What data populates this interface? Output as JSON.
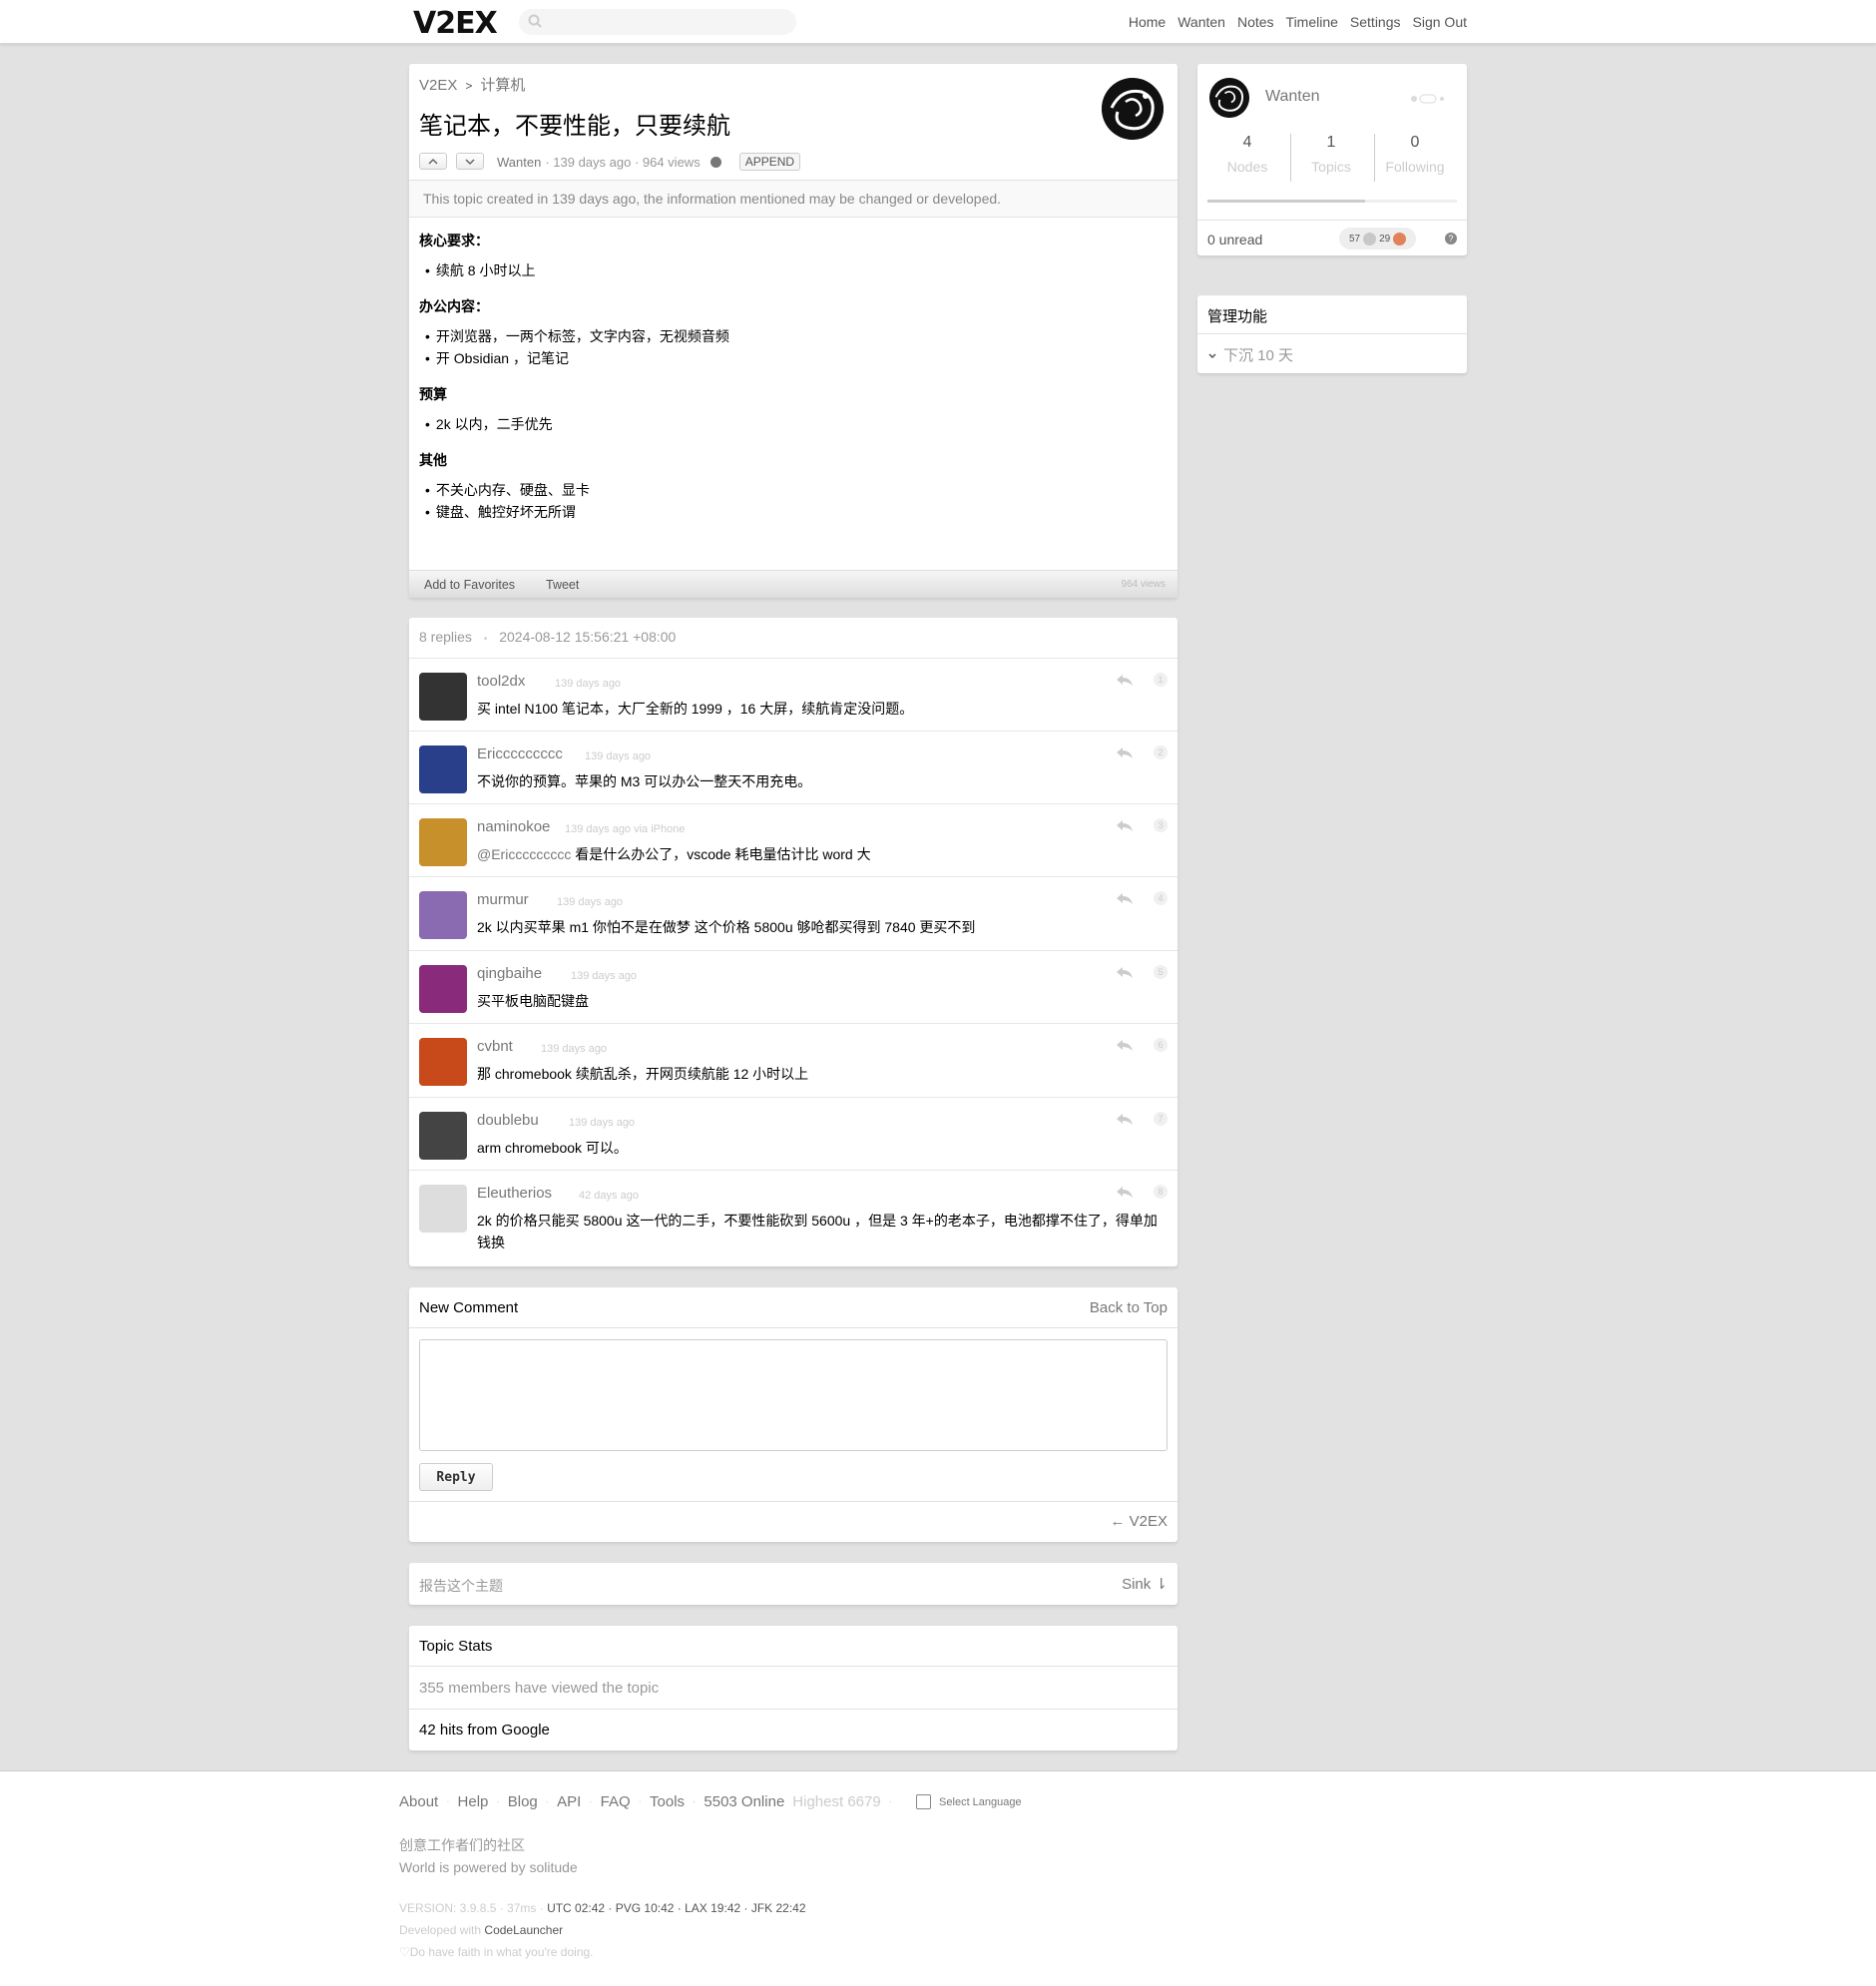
{
  "nav": {
    "logo": "V2EX",
    "links": [
      "Home",
      "Wanten",
      "Notes",
      "Timeline",
      "Settings",
      "Sign Out"
    ]
  },
  "topic": {
    "breadcrumb_home": "V2EX",
    "breadcrumb_sep": ">",
    "breadcrumb_node": "计算机",
    "title": "笔记本，不要性能，只要续航",
    "author": "Wanten",
    "meta_time": "· 139 days ago · 964 views",
    "append_label": "APPEND",
    "notice": "This topic created in 139 days ago, the information mentioned may be changed or developed.",
    "sections": [
      {
        "heading": "核心要求：",
        "items": [
          "续航 8 小时以上"
        ]
      },
      {
        "heading": "办公内容：",
        "items": [
          "开浏览器，一两个标签，文字内容，无视频音频",
          "开 Obsidian ，记笔记"
        ]
      },
      {
        "heading": "预算",
        "items": [
          "2k 以内，二手优先"
        ]
      },
      {
        "heading": "其他",
        "items": [
          "不关心内存、硬盘、显卡",
          "键盘、触控好坏无所谓"
        ]
      }
    ],
    "footer_fav": "Add to Favorites",
    "footer_tweet": "Tweet",
    "footer_views": "964 views"
  },
  "replies": {
    "count_label": "8 replies",
    "dot": "•",
    "date": "2024-08-12 15:56:21 +08:00",
    "items": [
      {
        "user": "tool2dx",
        "time": "139 days ago",
        "text": "买 intel N100 笔记本，大厂全新的 1999 ，16 大屏，续航肯定没问题。",
        "floor": "1",
        "color": "#333"
      },
      {
        "user": "Ericcccccccc",
        "time": "139 days ago",
        "text": "不说你的预算。苹果的 M3 可以办公一整天不用充电。",
        "floor": "2",
        "color": "#2a3f8a"
      },
      {
        "user": "naminokoe",
        "time": "139 days ago via iPhone",
        "mention": "@Ericcccccccc",
        "text": " 看是什么办公了，vscode 耗电量估计比 word 大",
        "floor": "3",
        "color": "#c8902a"
      },
      {
        "user": "murmur",
        "time": "139 days ago",
        "text": "2k 以内买苹果 m1 你怕不是在做梦 这个价格 5800u 够呛都买得到 7840 更买不到",
        "floor": "4",
        "color": "#8a6ab0"
      },
      {
        "user": "qingbaihe",
        "time": "139 days ago",
        "text": "买平板电脑配键盘",
        "floor": "5",
        "color": "#8a2a7a"
      },
      {
        "user": "cvbnt",
        "time": "139 days ago",
        "text": "那 chromebook 续航乱杀，开网页续航能 12 小时以上",
        "floor": "6",
        "color": "#c84a1a"
      },
      {
        "user": "doublebu",
        "time": "139 days ago",
        "text": "arm chromebook 可以。",
        "floor": "7",
        "color": "#444"
      },
      {
        "user": "Eleutherios",
        "time": "42 days ago",
        "text": "2k 的价格只能买 5800u 这一代的二手，不要性能砍到 5600u ，但是 3 年+的老本子，电池都撑不住了，得单加钱换",
        "floor": "8",
        "color": "#ddd"
      }
    ]
  },
  "comment": {
    "title": "New Comment",
    "back_to_top": "Back to Top",
    "reply_button": "Reply",
    "back_v2ex": "← V2EX"
  },
  "report": {
    "label": "报告这个主题",
    "sink": "Sink ⇂"
  },
  "stats": {
    "title": "Topic Stats",
    "viewed": "355 members have viewed the topic",
    "google": "42 hits from Google"
  },
  "sidebar": {
    "username": "Wanten",
    "nodes_n": "4",
    "nodes_l": "Nodes",
    "topics_n": "1",
    "topics_l": "Topics",
    "following_n": "0",
    "following_l": "Following",
    "progress_fraction": 0.63,
    "unread": "0 unread",
    "silver": "57",
    "bronze": "29",
    "admin_title": "管理功能",
    "admin_item": "下沉 10 天"
  },
  "footer": {
    "links": [
      "About",
      "Help",
      "Blog",
      "API",
      "FAQ",
      "Tools"
    ],
    "online": "5503 Online",
    "highest": "Highest 6679",
    "lang": "Select Language",
    "slogan1": "创意工作者们的社区",
    "slogan2": "World is powered by solitude",
    "version": "VERSION: 3.9.8.5 · 37ms ·",
    "times": "UTC 02:42 · PVG 10:42 · LAX 19:42 · JFK 22:42",
    "developed_prefix": "Developed with",
    "developed_tool": "CodeLauncher",
    "faith": "♡Do have faith in what you're doing."
  }
}
